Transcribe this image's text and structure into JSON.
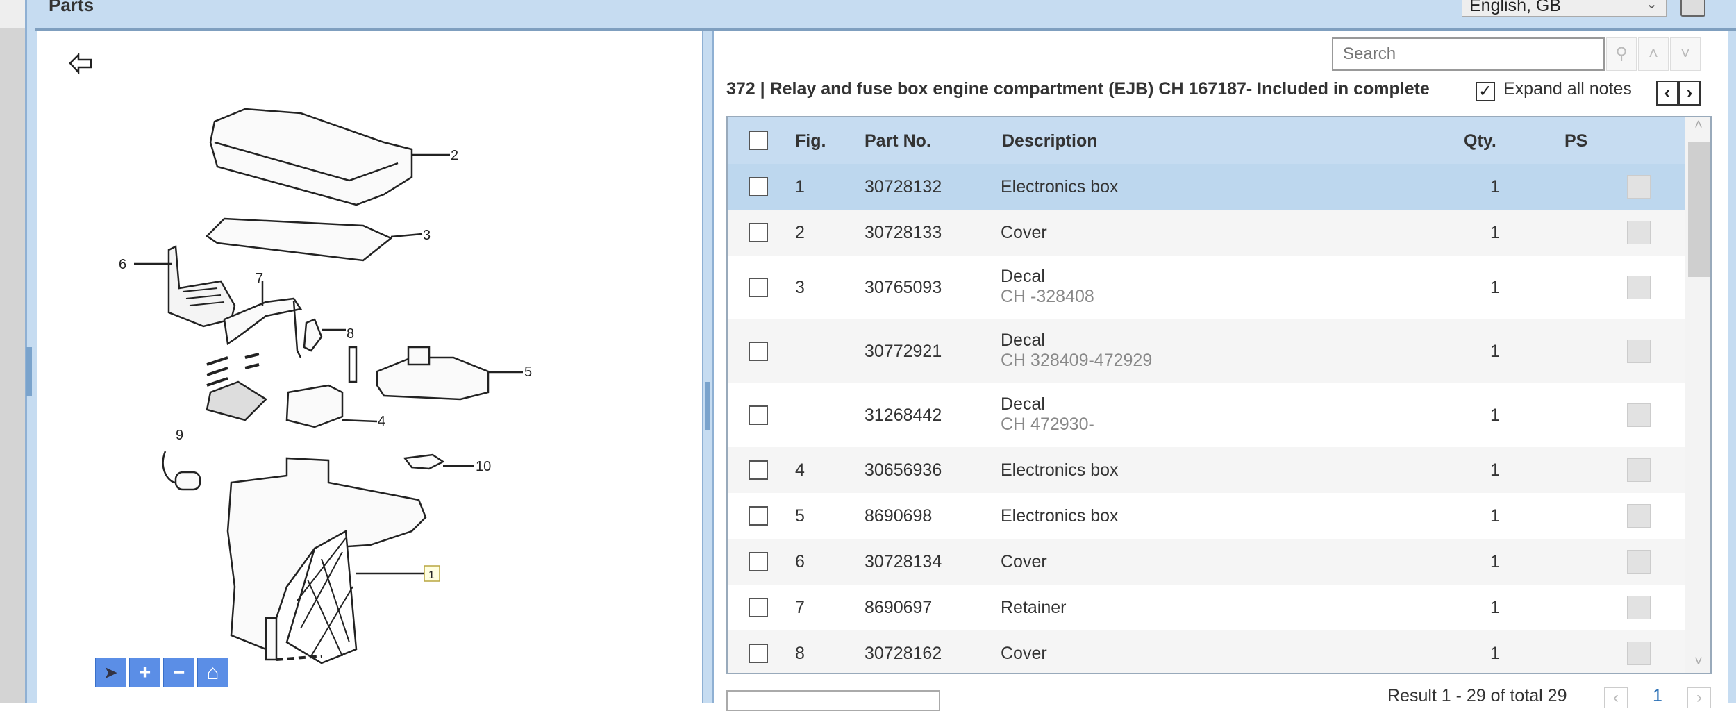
{
  "header": {
    "title": "Parts",
    "language": "English, GB"
  },
  "search": {
    "placeholder": "Search"
  },
  "section": {
    "title": "372  |  Relay and fuse box engine compartment (EJB) CH 167187- Included in complete",
    "expand_all_notes": "Expand all notes",
    "expand_checked": true
  },
  "table": {
    "columns": {
      "fig": "Fig.",
      "part_no": "Part No.",
      "description": "Description",
      "qty": "Qty.",
      "ps": "PS"
    },
    "rows": [
      {
        "fig": "1",
        "part_no": "30728132",
        "description": "Electronics box",
        "note": "",
        "qty": "1",
        "selected": true
      },
      {
        "fig": "2",
        "part_no": "30728133",
        "description": "Cover",
        "note": "",
        "qty": "1"
      },
      {
        "fig": "3",
        "part_no": "30765093",
        "description": "Decal",
        "note": "CH -328408",
        "qty": "1"
      },
      {
        "fig": "",
        "part_no": "30772921",
        "description": "Decal",
        "note": "CH 328409-472929",
        "qty": "1"
      },
      {
        "fig": "",
        "part_no": "31268442",
        "description": "Decal",
        "note": "CH 472930-",
        "qty": "1"
      },
      {
        "fig": "4",
        "part_no": "30656936",
        "description": "Electronics box",
        "note": "",
        "qty": "1"
      },
      {
        "fig": "5",
        "part_no": "8690698",
        "description": "Electronics box",
        "note": "",
        "qty": "1"
      },
      {
        "fig": "6",
        "part_no": "30728134",
        "description": "Cover",
        "note": "",
        "qty": "1"
      },
      {
        "fig": "7",
        "part_no": "8690697",
        "description": "Retainer",
        "note": "",
        "qty": "1"
      },
      {
        "fig": "8",
        "part_no": "30728162",
        "description": "Cover",
        "note": "",
        "qty": "1"
      }
    ]
  },
  "footer": {
    "result": "Result 1 - 29 of total 29",
    "page": "1"
  },
  "diagram": {
    "callouts": [
      "1",
      "2",
      "3",
      "4",
      "5",
      "6",
      "7",
      "8",
      "9",
      "10"
    ]
  },
  "colors": {
    "header_bg": "#c6dcf1",
    "selected_row": "#bdd7ee",
    "zoom_button": "#5b8ee6"
  }
}
